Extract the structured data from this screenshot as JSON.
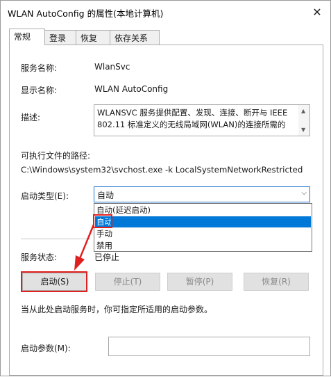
{
  "window": {
    "title": "WLAN AutoConfig 的属性(本地计算机)",
    "close_glyph": "✕"
  },
  "tabs": [
    {
      "label": "常规",
      "active": true
    },
    {
      "label": "登录",
      "active": false
    },
    {
      "label": "恢复",
      "active": false
    },
    {
      "label": "依存关系",
      "active": false
    }
  ],
  "general": {
    "service_name_label": "服务名称:",
    "service_name_value": "WlanSvc",
    "display_name_label": "显示名称:",
    "display_name_value": "WLAN AutoConfig",
    "description_label": "描述:",
    "description_line1": "WLANSVC 服务提供配置、发现、连接、断开与 IEEE",
    "description_line2": "802.11 标准定义的无线局域网(WLAN)的连接所需的",
    "path_label": "可执行文件的路径:",
    "path_value": "C:\\Windows\\system32\\svchost.exe -k LocalSystemNetworkRestricted",
    "startup_type_label": "启动类型(E):",
    "startup_type_value": "自动",
    "startup_options": [
      "自动(延迟启动)",
      "自动",
      "手动",
      "禁用"
    ],
    "startup_selected_index": 1,
    "status_label": "服务状态:",
    "status_value": "已停止",
    "buttons": {
      "start": "启动(S)",
      "stop": "停止(T)",
      "pause": "暂停(P)",
      "resume": "恢复(R)"
    },
    "hint": "当从此处启动服务时，你可指定所适用的启动参数。",
    "params_label": "启动参数(M):",
    "params_value": ""
  },
  "colors": {
    "highlight": "#0078d7",
    "annotation": "#e02020"
  }
}
